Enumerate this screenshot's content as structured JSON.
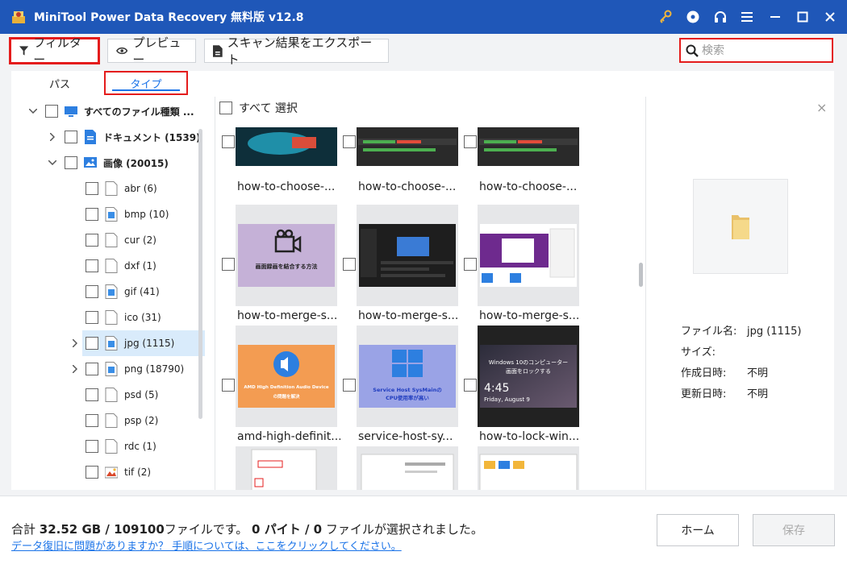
{
  "window": {
    "title": "MiniTool Power Data Recovery 無料版 v12.8"
  },
  "toolbar": {
    "filter_label": "フィルター",
    "preview_label": "プレビュー",
    "export_label": "スキャン結果をエクスポート",
    "search_placeholder": "検索"
  },
  "tabs": {
    "path": "パス",
    "type": "タイプ"
  },
  "tree": {
    "root": "すべてのファイル種類 ...",
    "documents": "ドキュメント (1539)",
    "images": "画像 (20015)",
    "items": [
      "abr (6)",
      "bmp (10)",
      "cur (2)",
      "dxf (1)",
      "gif (41)",
      "ico (31)",
      "jpg (1115)",
      "png (18790)",
      "psd (5)",
      "psp (2)",
      "rdc (1)",
      "tif (2)"
    ]
  },
  "grid": {
    "select_all": "すべて 選択",
    "row1": [
      "how-to-choose-...",
      "how-to-choose-...",
      "how-to-choose-..."
    ],
    "row2": [
      "how-to-merge-s...",
      "how-to-merge-s...",
      "how-to-merge-s..."
    ],
    "row3": [
      "amd-high-definit...",
      "service-host-sy...",
      "how-to-lock-win..."
    ],
    "thumb_texts": {
      "screen_record": "画面録画を結合する方法",
      "amd_line1": "AMD High Definition Audio Device",
      "amd_line2": "の問題を解決",
      "svc_line1": "Service Host SysMainの",
      "svc_line2": "CPU使用率が高い",
      "win_title1": "Windows 10のコンピューター",
      "win_title2": "画面をロックする",
      "lock_time": "4:45",
      "lock_date": "Friday, August 9"
    }
  },
  "preview": {
    "filename_label": "ファイル名:",
    "filename_value": "jpg (1115)",
    "size_label": "サイズ:",
    "size_value": "",
    "created_label": "作成日時:",
    "created_value": "不明",
    "modified_label": "更新日時:",
    "modified_value": "不明"
  },
  "bottom": {
    "total_prefix": "合計 ",
    "total_size": "32.52 GB",
    "total_sep": " / ",
    "total_files": "109100",
    "total_suffix": "ファイルです。 ",
    "selected_bytes": "0 パイト",
    "selected_sep": " / ",
    "selected_count": "0",
    "selected_suffix": " ファイルが選択されました。",
    "help_link": "データ復旧に問題がありますか？ 手順については、ここをクリックしてください。",
    "home_label": "ホーム",
    "save_label": "保存"
  }
}
